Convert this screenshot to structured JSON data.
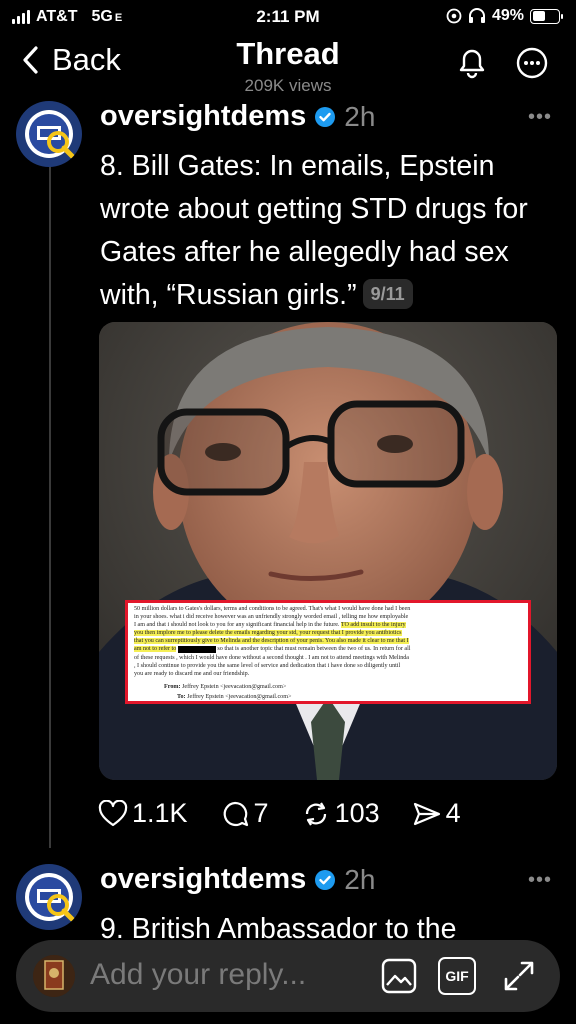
{
  "status_bar": {
    "carrier": "AT&T",
    "network": "5G",
    "network_suffix": "E",
    "time": "2:11 PM",
    "battery": "49%",
    "battery_level": 0.49
  },
  "header": {
    "back_label": "Back",
    "title": "Thread",
    "subtitle": "209K views"
  },
  "posts": [
    {
      "author": "oversightdems",
      "time": "2h",
      "text": "8. Bill Gates: In emails, Epstein wrote about getting STD drugs for Gates after he allegedly had sex with, “Russian girls.”",
      "counter": "9/11",
      "actions": {
        "likes": "1.1K",
        "replies": "7",
        "reposts": "103",
        "shares": "4"
      }
    },
    {
      "author": "oversightdems",
      "time": "2h",
      "text": "9. British Ambassador to the"
    }
  ],
  "document": {
    "line1": "50 million dollars to Gates's dollars, terms and conditions to be agreed. That's what I would have done had I been",
    "line2": "in your shoes. what i did receive however was an unfriendly strongly worded email , telling me how employable",
    "line3": "I am and that i should not look to you for any significant financial help in the future.",
    "hl1": "TO add insult to the injury",
    "hl2": "you then implore me to please delete the emails regarding your std, your request that I provide you antibiotics",
    "hl3": "that you can surreptitiously give to Melinda and the description of your penis. You also made it clear to me that I",
    "hl4a": "am not to refer to",
    "hl4b": "so that is another topic that must remain between the two of us.",
    "line5": "In return for all",
    "line6": "of these requests , which I would have done without a second thought . I am not to attend meetings with Melinda",
    "line7": ", I should continue to provide you the same level of service and dedication that i have done so diligently until",
    "line8": "you are ready to discard me and our friendship.",
    "from_label": "From:",
    "from_value": "Jeffrey Epstein <jeevacation@gmail.com>",
    "to_label": "To:",
    "to_value": "Jeffrey Epstein <jeevacation@gmail.com>"
  },
  "reply_bar": {
    "placeholder": "Add your reply...",
    "gif_label": "GIF"
  },
  "colors": {
    "background": "#000000",
    "secondary_text": "#8a8a8a",
    "verified": "#1d9bf0",
    "highlight": "#f5ef55",
    "doc_border": "#e2172b"
  }
}
